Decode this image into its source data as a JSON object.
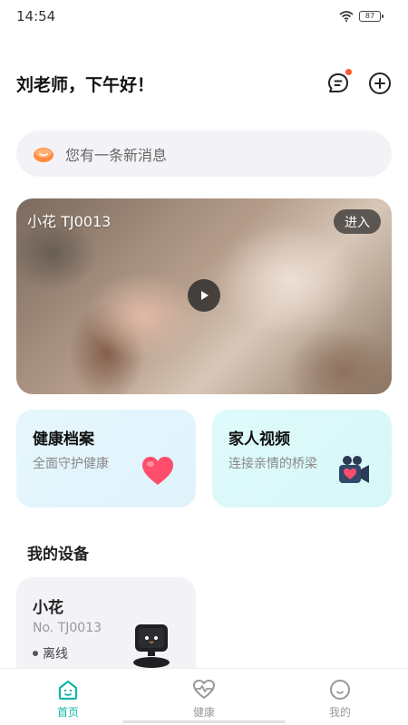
{
  "status_bar": {
    "time": "14:54",
    "battery": "87"
  },
  "header": {
    "greeting": "刘老师，下午好！"
  },
  "message": {
    "text": "您有一条新消息"
  },
  "video_card": {
    "title": "小花  TJ0013",
    "enter_label": "进入"
  },
  "features": [
    {
      "title": "健康档案",
      "subtitle": "全面守护健康"
    },
    {
      "title": "家人视频",
      "subtitle": "连接亲情的桥梁"
    }
  ],
  "devices_section": {
    "title": "我的设备"
  },
  "device": {
    "name": "小花",
    "number": "No. TJ0013",
    "status": "离线"
  },
  "tabs": [
    {
      "label": "首页",
      "icon": "home-icon",
      "active": true
    },
    {
      "label": "健康",
      "icon": "health-heart-icon",
      "active": false
    },
    {
      "label": "我的",
      "icon": "profile-icon",
      "active": false
    }
  ],
  "colors": {
    "accent": "#10b7a7",
    "notification": "#ff5a2c",
    "heart": "#ff4d6d"
  }
}
